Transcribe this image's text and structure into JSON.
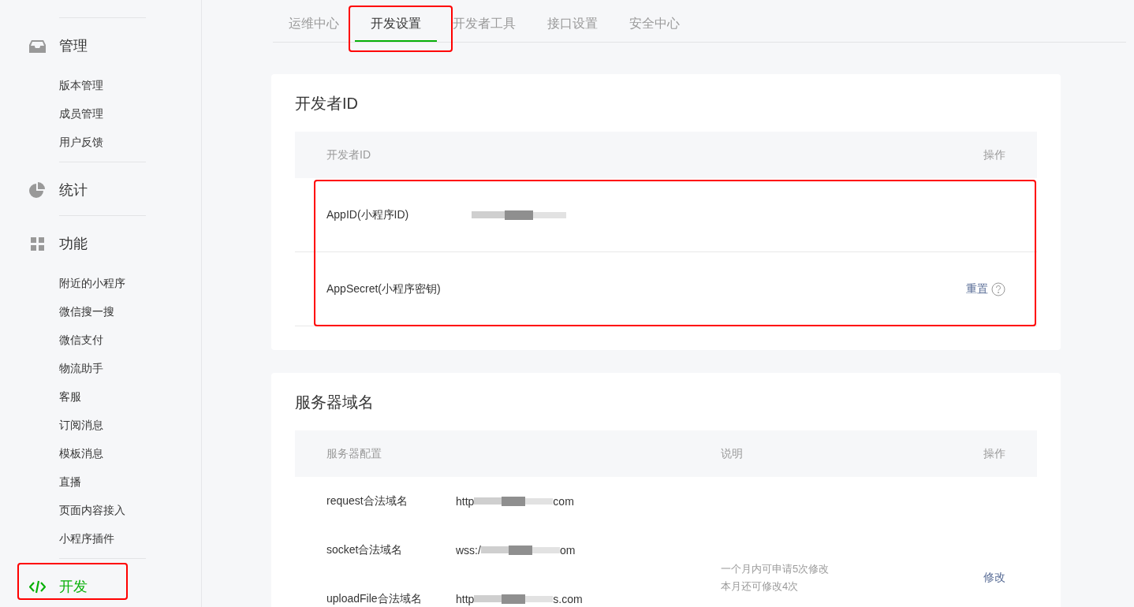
{
  "sidebar": {
    "groups": [
      {
        "label": "管理",
        "selected": false,
        "highlighted": false,
        "items": [
          "版本管理",
          "成员管理",
          "用户反馈"
        ]
      },
      {
        "label": "统计",
        "selected": false,
        "highlighted": false
      },
      {
        "label": "功能",
        "selected": false,
        "highlighted": false,
        "items": [
          "附近的小程序",
          "微信搜一搜",
          "微信支付",
          "物流助手",
          "客服",
          "订阅消息",
          "模板消息",
          "直播",
          "页面内容接入",
          "小程序插件"
        ]
      },
      {
        "label": "开发",
        "selected": true,
        "highlighted": true
      }
    ]
  },
  "tabs": [
    {
      "label": "运维中心",
      "selected": false,
      "highlighted": false
    },
    {
      "label": "开发设置",
      "selected": true,
      "highlighted": true
    },
    {
      "label": "开发者工具",
      "selected": false,
      "highlighted": false
    },
    {
      "label": "接口设置",
      "selected": false,
      "highlighted": false
    },
    {
      "label": "安全中心",
      "selected": false,
      "highlighted": false
    }
  ],
  "developer_id": {
    "title": "开发者ID",
    "columns": [
      "开发者ID",
      "操作"
    ],
    "highlighted": true,
    "rows": [
      {
        "label": "AppID(小程序ID)",
        "redacted": true,
        "action": null,
        "help": false
      },
      {
        "label": "AppSecret(小程序密钥)",
        "redacted": false,
        "action": "重置",
        "help": true
      }
    ]
  },
  "server_domains": {
    "title": "服务器域名",
    "columns": [
      "服务器配置",
      "说明",
      "操作"
    ],
    "rows": [
      {
        "label": "request合法域名",
        "value_prefix": "http",
        "value_suffix": "com"
      },
      {
        "label": "socket合法域名",
        "value_prefix": "wss:/",
        "value_suffix": "om"
      },
      {
        "label": "uploadFile合法域名",
        "value_prefix": "http",
        "value_suffix": "s.com"
      }
    ],
    "note": [
      "一个月内可申请5次修改",
      "本月还可修改4次"
    ],
    "action": "修改"
  }
}
